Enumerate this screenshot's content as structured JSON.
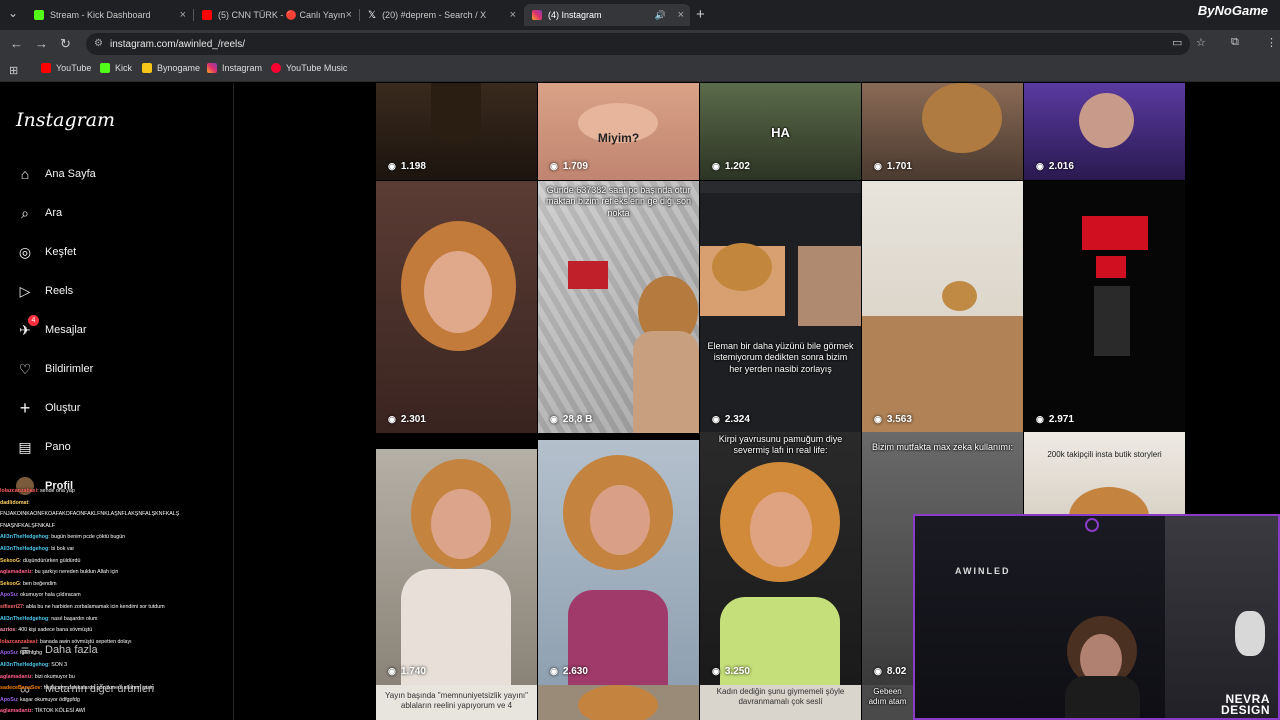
{
  "browser": {
    "tabs": [
      {
        "label": "Stream - Kick Dashboard",
        "color": "#53fc18"
      },
      {
        "label": "(5) CNN TÜRK - 🔴 Canlı Yayın",
        "color": "#ff0000"
      },
      {
        "label": "(20) #deprem - Search / X",
        "color": "#ffffff"
      },
      {
        "label": "(4) Instagram",
        "color": "#e1306c"
      }
    ],
    "url": "instagram.com/awinled_/reels/",
    "bookmarks": [
      {
        "label": "YouTube",
        "color": "#ff0000"
      },
      {
        "label": "Kick",
        "color": "#53fc18"
      },
      {
        "label": "Bynogame",
        "color": "#f5c518"
      },
      {
        "label": "Instagram",
        "color": "#e1306c"
      },
      {
        "label": "YouTube Music",
        "color": "#ff0033"
      }
    ],
    "brand": "ByNoGame"
  },
  "sidebar": {
    "logo": "Instagram",
    "items": [
      {
        "label": "Ana Sayfa",
        "icon": "home-icon",
        "glyph": "⌂"
      },
      {
        "label": "Ara",
        "icon": "search-icon",
        "glyph": "⌕"
      },
      {
        "label": "Keşfet",
        "icon": "compass-icon",
        "glyph": "◎"
      },
      {
        "label": "Reels",
        "icon": "reels-icon",
        "glyph": "▷"
      },
      {
        "label": "Mesajlar",
        "icon": "messenger-icon",
        "glyph": "✈"
      },
      {
        "label": "Bildirimler",
        "icon": "heart-icon",
        "glyph": "♡"
      },
      {
        "label": "Oluştur",
        "icon": "plus-icon",
        "glyph": "+"
      },
      {
        "label": "Pano",
        "icon": "dashboard-icon",
        "glyph": "▤"
      },
      {
        "label": "Profil",
        "icon": "avatar",
        "glyph": "●"
      }
    ],
    "messages_badge": "4",
    "more_label": "Daha fazla",
    "meta_label": "Meta'nın diğer ürünleri"
  },
  "reels": [
    {
      "views": "1.198",
      "caption": ""
    },
    {
      "views": "1.709",
      "caption": "Miyim?"
    },
    {
      "views": "1.202",
      "caption": "HA"
    },
    {
      "views": "1.701",
      "caption": ""
    },
    {
      "views": "2.016",
      "caption": ""
    },
    {
      "views": "2.301",
      "caption": ""
    },
    {
      "views": "28,8 B",
      "caption": "Günde 637382 saat pc başında otur maktan bizim reflekslerin ge diği son nokta"
    },
    {
      "views": "2.324",
      "caption": "Eleman bir daha yüzünü bile görmek istemiyorum dedikten sonra bizim her yerden nasibi zorlayış"
    },
    {
      "views": "3.563",
      "caption": ""
    },
    {
      "views": "2.971",
      "caption": ""
    },
    {
      "views": "1.740",
      "caption": ""
    },
    {
      "views": "2.630",
      "caption": ""
    },
    {
      "views": "3.250",
      "caption": "Kirpi yavrusunu pamuğum diye severmiş lafı in real life:"
    },
    {
      "views": "8.02",
      "caption": "Bizim mutfakta max zeka kullanımı:"
    },
    {
      "views": "",
      "caption": "200k takipçili insta butik storyleri"
    },
    {
      "views": "",
      "caption": "Yayın başında \"memnuniyetsizlik yayını\" ablaların reelini yapıyorum ve 4"
    },
    {
      "views": "",
      "caption": ""
    },
    {
      "views": "",
      "caption": "Kadın dediğin şunu giymemeli şöyle davranmamalı çok seslí"
    },
    {
      "views": "",
      "caption": "Gebeen adım atam"
    }
  ],
  "chat": [
    {
      "user": "lolazcanzabasi",
      "text": ": sende ona yap",
      "color": "#ff5c5c"
    },
    {
      "user": "dadlidomat",
      "text": ":",
      "color": "#ffd166"
    },
    {
      "user": "",
      "text": "FNJAKOINKAONFKOAFAKOFAONFAKLFNKLAŞNFLAKŞNFALŞKNFKALŞ",
      "color": "#ffffff"
    },
    {
      "user": "",
      "text": "FNAŞNFKALŞFNKALF",
      "color": "#ffffff"
    },
    {
      "user": "All3nTheHedgehog",
      "text": ": bugün benim pcde çöktü bugün",
      "color": "#4cc9f0"
    },
    {
      "user": "All3nTheHedgehog",
      "text": ": bi bok var",
      "color": "#4cc9f0"
    },
    {
      "user": "SekooG",
      "text": ": düşündürürken güldürdü",
      "color": "#f9c74f"
    },
    {
      "user": "aglamadaniz",
      "text": ": bu şarkıyı nereden buldun Allah için",
      "color": "#ff5c8a"
    },
    {
      "user": "SekooG",
      "text": ": ben beğendim",
      "color": "#f9c74f"
    },
    {
      "user": "ApoSu",
      "text": ": okumuyor hala çıldıracam",
      "color": "#9b5de5"
    },
    {
      "user": "sifiseri27",
      "text": ": abla bu ne harbiden zorbalamamak icin kendimi sor tutdum",
      "color": "#ff6b6b"
    },
    {
      "user": "All3nTheHedgehog",
      "text": ": nasıl başardın olum",
      "color": "#4cc9f0"
    },
    {
      "user": "azrios",
      "text": ": 400 kişi sadece bana sövmüştü",
      "color": "#ff8fab"
    },
    {
      "user": "lolazcanzabasi",
      "text": ": banada awin sövmüştü sepetten dolayı",
      "color": "#ff5c5c"
    },
    {
      "user": "ApoSu",
      "text": ": fghfhfghg",
      "color": "#9b5de5"
    },
    {
      "user": "All3nTheHedgehog",
      "text": ": SON 3",
      "color": "#4cc9f0"
    },
    {
      "user": "aglamadaniz",
      "text": ": bizi okumuyor bu",
      "color": "#ff5c8a"
    },
    {
      "user": "sadeceBanaSov",
      "text": ": hepsi ayrı dakikalarda gözükmedi allahım iyisin",
      "color": "#f77f00"
    },
    {
      "user": "ApoSu",
      "text": ": kaşar okumuyor ödfgpfdg",
      "color": "#9b5de5"
    },
    {
      "user": "aglamadaniz",
      "text": ": TİKTOK KÖLESİ AWİ",
      "color": "#ff5c8a"
    }
  ],
  "webcam": {
    "wall_text": "AWINLED"
  },
  "watermark": {
    "line1": "NEVRA",
    "line2": "DESIGN"
  }
}
